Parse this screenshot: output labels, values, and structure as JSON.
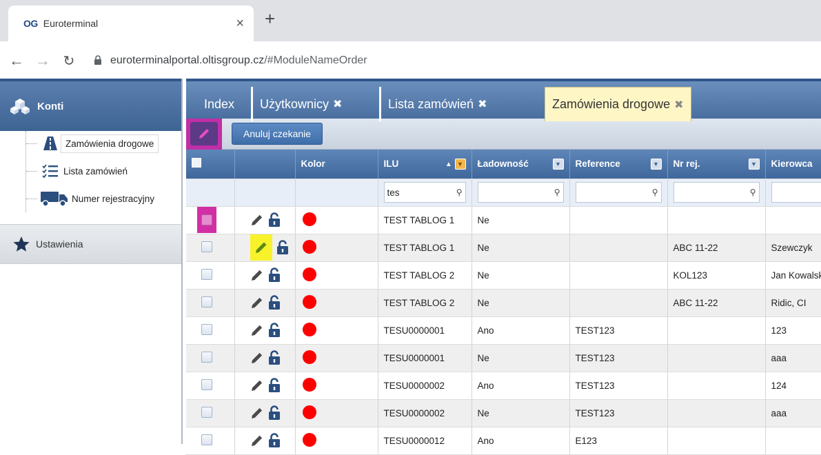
{
  "browser": {
    "favicon": "OG",
    "tab_title": "Euroterminal",
    "tab_close": "×",
    "new_tab": "+",
    "url_host": "euroterminalportal.oltisgroup.cz",
    "url_path": "/#ModuleNameOrder"
  },
  "sidebar": {
    "header": "Konti",
    "items": [
      {
        "label": "Zamówienia drogowe",
        "icon": "road-icon",
        "active": true
      },
      {
        "label": "Lista zamówień",
        "icon": "checklist-icon",
        "active": false
      },
      {
        "label": "Numer rejestracyjny",
        "icon": "truck-icon",
        "active": false
      }
    ],
    "settings": "Ustawienia"
  },
  "tabs": [
    {
      "label": "Index",
      "closable": false
    },
    {
      "label": "Użytkownicy",
      "closable": true
    },
    {
      "label": "Lista zamówień",
      "closable": true
    },
    {
      "label": "Zamówienia drogowe",
      "closable": true,
      "active": true
    }
  ],
  "tab_close_glyph": "✖",
  "toolbar": {
    "cancel_label": "Anuluj czekanie"
  },
  "grid": {
    "columns": {
      "kolor": "Kolor",
      "ilu": "ILU",
      "ladownosc": "Ładowność",
      "reference": "Reference",
      "nrrej": "Nr rej.",
      "kierowca": "Kierowca"
    },
    "filters": {
      "ilu": "tes",
      "ladownosc": "",
      "reference": "",
      "nrrej": "",
      "kierowca": ""
    },
    "rows": [
      {
        "ilu": "TEST TABLOG 1",
        "ladownosc": "Ne",
        "reference": "",
        "nrrej": "",
        "kierowca": ""
      },
      {
        "ilu": "TEST TABLOG 1",
        "ladownosc": "Ne",
        "reference": "",
        "nrrej": "ABC 11-22",
        "kierowca": "Szewczyk"
      },
      {
        "ilu": "TEST TABLOG 2",
        "ladownosc": "Ne",
        "reference": "",
        "nrrej": "KOL123",
        "kierowca": "Jan Kowalski"
      },
      {
        "ilu": "TEST TABLOG 2",
        "ladownosc": "Ne",
        "reference": "",
        "nrrej": "ABC 11-22",
        "kierowca": "Ridic, CI"
      },
      {
        "ilu": "TESU0000001",
        "ladownosc": "Ano",
        "reference": "TEST123",
        "nrrej": "",
        "kierowca": "123"
      },
      {
        "ilu": "TESU0000001",
        "ladownosc": "Ne",
        "reference": "TEST123",
        "nrrej": "",
        "kierowca": "aaa"
      },
      {
        "ilu": "TESU0000002",
        "ladownosc": "Ano",
        "reference": "TEST123",
        "nrrej": "",
        "kierowca": "124"
      },
      {
        "ilu": "TESU0000002",
        "ladownosc": "Ne",
        "reference": "TEST123",
        "nrrej": "",
        "kierowca": "aaa"
      },
      {
        "ilu": "TESU0000012",
        "ladownosc": "Ano",
        "reference": "E123",
        "nrrej": "",
        "kierowca": ""
      }
    ],
    "row_color": "#ff0000"
  },
  "highlights": {
    "magenta": "#d12fa3",
    "yellow": "#f7f22a"
  }
}
